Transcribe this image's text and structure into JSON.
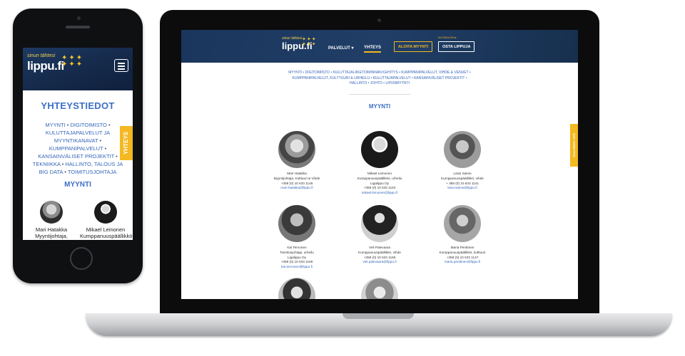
{
  "phone": {
    "logo_tagline": "sinun tähtesi",
    "logo": "lippu.fi",
    "title": "YHTEYSTIEDOT",
    "links": [
      "MYYNTI",
      "DIGITOIMISTO",
      "KULUTTAJAPALVELUT JA MYYNTIKANAVAT",
      "KUMPPANIPALVELUT",
      "KANSAINVÄLISET PROJEKTIT",
      "TEKNIIKKA",
      "HALLINTO, TALOUS JA BIG DATA",
      "TOIMITUSJOHTAJA"
    ],
    "section": "MYYNTI",
    "side_tab": "YHTEYS",
    "people": [
      {
        "name": "Mari Hatakka",
        "role": "Myyntijohtaja, Kulttuuri & Vihde"
      },
      {
        "name": "Mikael Leinonen",
        "role": "Kumppanuuspäällikkö, urheilu"
      }
    ]
  },
  "laptop": {
    "logo_tagline": "sinun tähtesi",
    "logo": "lippu.fi",
    "nav": {
      "palvelut": "PALVELUT ▾",
      "yhteys": "YHTEYS"
    },
    "buttons": {
      "start_selling": "ALOITA MYYNTI",
      "buy_ticket": "OSTA LIPPUJA"
    },
    "english": "IN ENGLISH ▸",
    "breadcrumbs": "MYYNTI • DIGITOIMISTO • KULUTTAJALIIKETOIMINNAN KEHITYS • KUMPPANIPALVELUT, VIHDE & VENUET • KUMPPANIPALVELUT, KULTTUURI & URHEILU • KULUTTAJAPALVELUT • KANSAINVÄLISET PROJEKTIT • HALLINTO • JOHTO • LIPUNMYYNTI",
    "section": "MYYNTI",
    "side_tab": "OTA YHTEYTTÄ",
    "people": [
      {
        "name": "Mari Hatakka",
        "role": "Myyntijohtaja, Kulttuuri & Vihde",
        "company": "",
        "phone": "+358 (0) 10 633 1146",
        "email": "mari.hatakka@lippu.fi"
      },
      {
        "name": "Mikael Leinonen",
        "role": "Kumppanuuspäällikkö, urheilu",
        "company": "Ligalippu Oy",
        "phone": "+358 (0) 10 633 1163",
        "email": "mikael.leinonen@lippu.fi"
      },
      {
        "name": "Lassi Sainio",
        "role": "Kumppanuuspäällikkö, vihde",
        "company": "",
        "phone": "+ 358 (0) 10 633 1141",
        "email": "lassi.sainio@lippu.fi"
      },
      {
        "name": "Kai Tervonen",
        "role": "Toimitusjohtaja, urheilu",
        "company": "Ligalippu Oy",
        "phone": "+358 (0) 10 633 1166",
        "email": "kai.tervonen@lippu.fi"
      },
      {
        "name": "Veli Palevaara",
        "role": "Kumppanuuspäällikkö, vihde",
        "company": "",
        "phone": "+358 (0) 10 633 1165",
        "email": "veli.palevaara@lippu.fi"
      },
      {
        "name": "Maria Penttinen",
        "role": "Kumppanuuspäällikkö, kulttuuri",
        "company": "",
        "phone": "+358 (0) 10 633 1147",
        "email": "maria.penttinen@lippu.fi"
      }
    ]
  }
}
